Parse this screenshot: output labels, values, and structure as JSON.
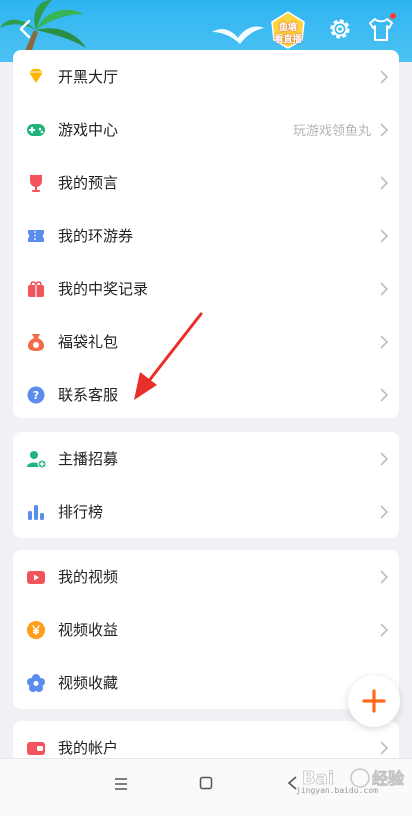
{
  "header": {
    "back_icon": "chevron-left-icon",
    "badge_line1": "鱼塘",
    "badge_line2": "看直播",
    "settings_icon": "gear-icon",
    "skin_icon": "tshirt-icon"
  },
  "menu_group_1": [
    {
      "label": "开黑大厅",
      "icon": "diamond-icon",
      "color": "#ffb400"
    },
    {
      "label": "游戏中心",
      "icon": "gamepad-icon",
      "color": "#1fb57a",
      "hint": "玩游戏领鱼丸"
    },
    {
      "label": "我的预言",
      "icon": "trophy-icon",
      "color": "#f2545b"
    },
    {
      "label": "我的环游券",
      "icon": "ticket-icon",
      "color": "#5b8def"
    },
    {
      "label": "我的中奖记录",
      "icon": "gift-box-icon",
      "color": "#f2545b"
    },
    {
      "label": "福袋礼包",
      "icon": "lucky-bag-icon",
      "color": "#f26b4a"
    },
    {
      "label": "联系客服",
      "icon": "help-icon",
      "color": "#5b8def"
    }
  ],
  "menu_group_2": [
    {
      "label": "主播招募",
      "icon": "add-person-icon",
      "color": "#1fb57a"
    },
    {
      "label": "排行榜",
      "icon": "bar-chart-icon",
      "color": "#5b8def"
    }
  ],
  "menu_group_3": [
    {
      "label": "我的视频",
      "icon": "video-icon",
      "color": "#f2545b"
    },
    {
      "label": "视频收益",
      "icon": "yen-coin-icon",
      "color": "#ff9f1a"
    },
    {
      "label": "视频收藏",
      "icon": "flower-icon",
      "color": "#5b8def"
    }
  ],
  "menu_group_4": [
    {
      "label": "我的帐户",
      "icon": "wallet-icon",
      "color": "#f2545b"
    }
  ],
  "fab": {
    "icon": "plus-icon",
    "color": "#ff6a1a"
  },
  "navbar": {
    "menu_icon": "menu-lines-icon",
    "home_icon": "square-home-icon",
    "back_icon": "triangle-back-icon"
  },
  "watermark": {
    "text": "jingyan.baidu.com"
  }
}
